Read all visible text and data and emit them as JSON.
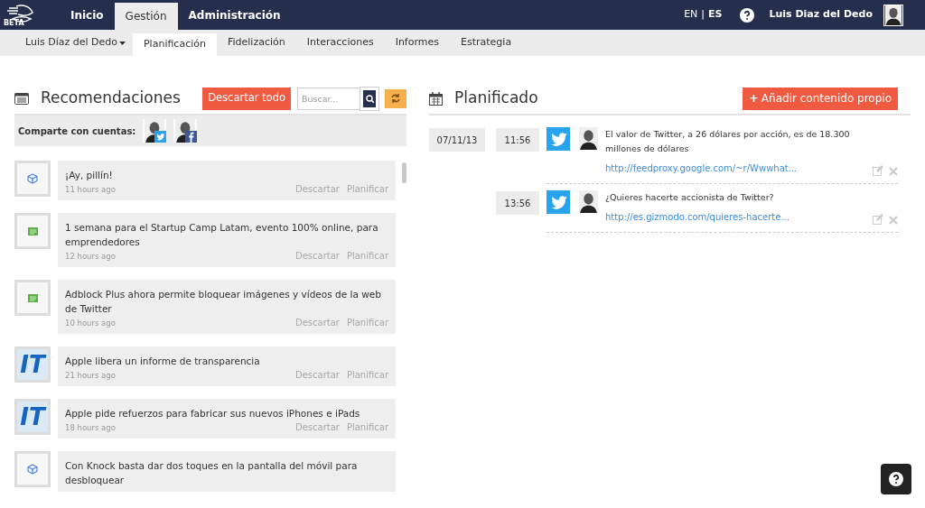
{
  "topbar": {
    "logo_text": "BETA",
    "tabs": [
      {
        "label": "Inicio",
        "selected": false
      },
      {
        "label": "Gestión",
        "selected": true
      },
      {
        "label": "Administración",
        "selected": false
      }
    ],
    "languages": [
      {
        "label": "EN",
        "selected": false
      },
      {
        "label": "ES",
        "selected": true
      }
    ],
    "separator": "|",
    "user": "Luis Diaz del Dedo"
  },
  "subnav": {
    "account": "Luis Díaz del Dedo",
    "tabs": [
      {
        "label": "Planificación",
        "selected": true
      },
      {
        "label": "Fidelización",
        "selected": false
      },
      {
        "label": "Interacciones",
        "selected": false
      },
      {
        "label": "Informes",
        "selected": false
      },
      {
        "label": "Estrategia",
        "selected": false
      }
    ]
  },
  "recommendations": {
    "title": "Recomendaciones",
    "discard_all": "Descartar todo",
    "search": {
      "placeholder": "Buscar..."
    },
    "share_label": "Comparte con cuentas:",
    "accounts": [
      {
        "kind": "twitter"
      },
      {
        "kind": "facebook"
      }
    ],
    "items": [
      {
        "favicon": {
          "kind": "cube"
        },
        "title": "¡Ay, pillín!",
        "time": "11 hours ago",
        "discard": "Descartar",
        "plan": "Planificar"
      },
      {
        "favicon": {
          "kind": "book"
        },
        "title": "1 semana para el Startup Camp Latam, evento 100% online, para emprendedores",
        "time": "12 hours ago",
        "discard": "Descartar",
        "plan": "Planificar"
      },
      {
        "favicon": {
          "kind": "book"
        },
        "title": "Adblock Plus ahora permite bloquear imágenes y vídeos de la web de Twitter",
        "time": "10 hours ago",
        "discard": "Descartar",
        "plan": "Planificar"
      },
      {
        "favicon": {
          "kind": "letters",
          "text": "IT"
        },
        "title": "Apple libera un informe de transparencia",
        "time": "21 hours ago",
        "discard": "Descartar",
        "plan": "Planificar"
      },
      {
        "favicon": {
          "kind": "letters",
          "text": "IT"
        },
        "title": "Apple pide refuerzos para fabricar sus nuevos iPhones e iPads",
        "time": "18 hours ago",
        "discard": "Descartar",
        "plan": "Planificar"
      },
      {
        "favicon": {
          "kind": "cube"
        },
        "title": "Con Knock basta dar dos toques en la pantalla del móvil para desbloquear"
      }
    ]
  },
  "planned": {
    "title": "Planificado",
    "add_button": "Añadir contenido propio",
    "plus": "+",
    "posts": [
      {
        "date": "07/11/13",
        "time": "11:56",
        "kind": "twitter",
        "text": "El valor de Twitter, a 26 dólares por acción, es de 18.300 millones de dólares",
        "link": "http://feedproxy.google.com/~r/Wwwhat..."
      },
      {
        "time": "13:56",
        "kind": "twitter",
        "text": "¿Quieres hacerte accionista de Twitter?",
        "link": "http://es.gizmodo.com/quieres-hacerte..."
      }
    ]
  }
}
